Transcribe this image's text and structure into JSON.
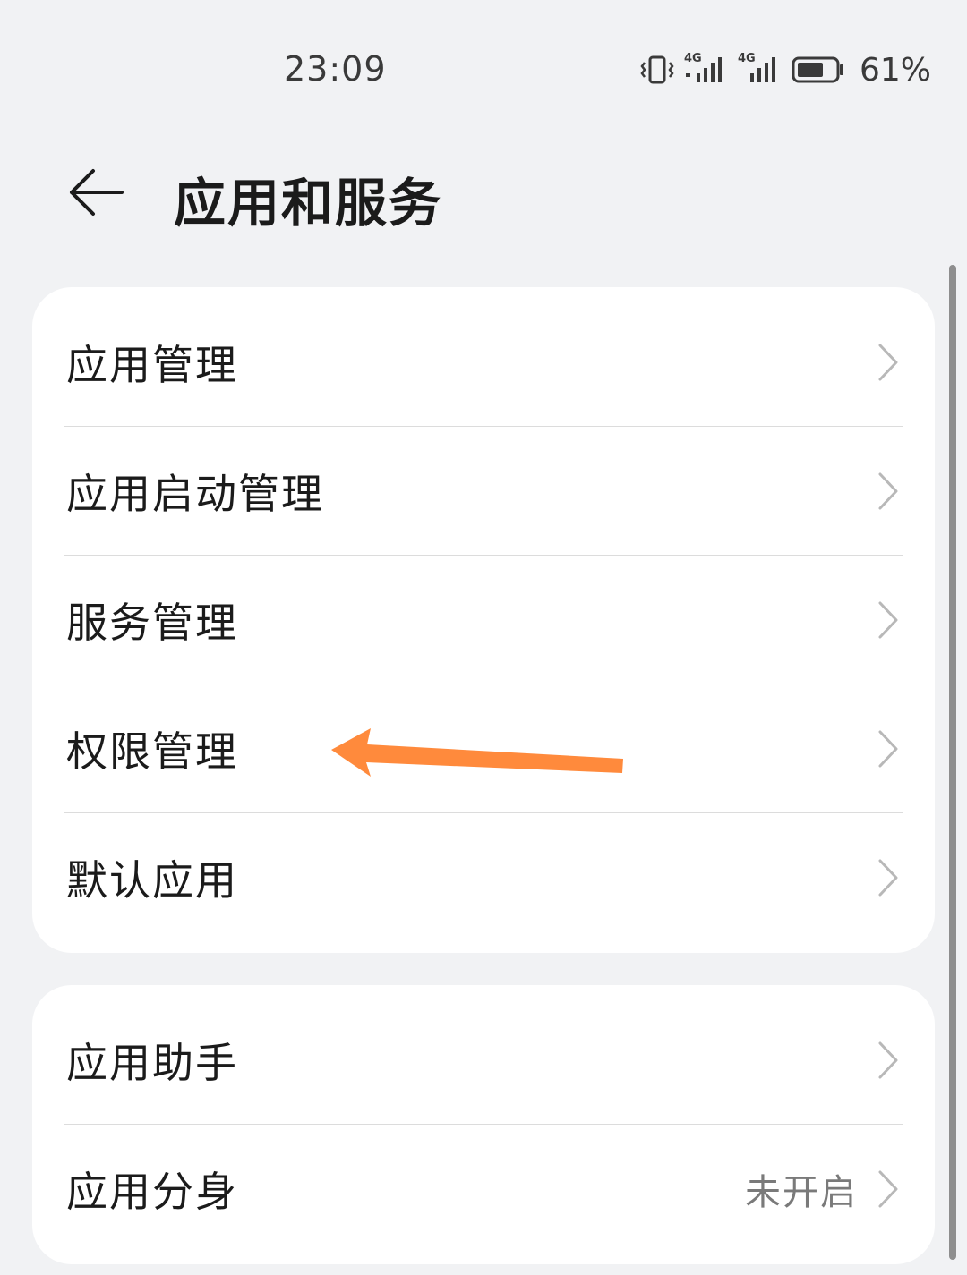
{
  "status_bar": {
    "time": "23:09",
    "network_1": "4G",
    "network_2": "4G",
    "battery": "61%"
  },
  "header": {
    "title": "应用和服务"
  },
  "group_1": [
    {
      "label": "应用管理"
    },
    {
      "label": "应用启动管理"
    },
    {
      "label": "服务管理"
    },
    {
      "label": "权限管理"
    },
    {
      "label": "默认应用"
    }
  ],
  "group_2": [
    {
      "label": "应用助手",
      "value": ""
    },
    {
      "label": "应用分身",
      "value": "未开启"
    }
  ],
  "colors": {
    "background": "#f1f2f4",
    "card": "#ffffff",
    "annotation_arrow": "#ff8a3c"
  },
  "icons": {
    "back": "arrow-left-icon",
    "chevron": "chevron-right-icon",
    "vibrate": "vibrate-icon",
    "signal": "signal-icon",
    "battery": "battery-icon"
  }
}
